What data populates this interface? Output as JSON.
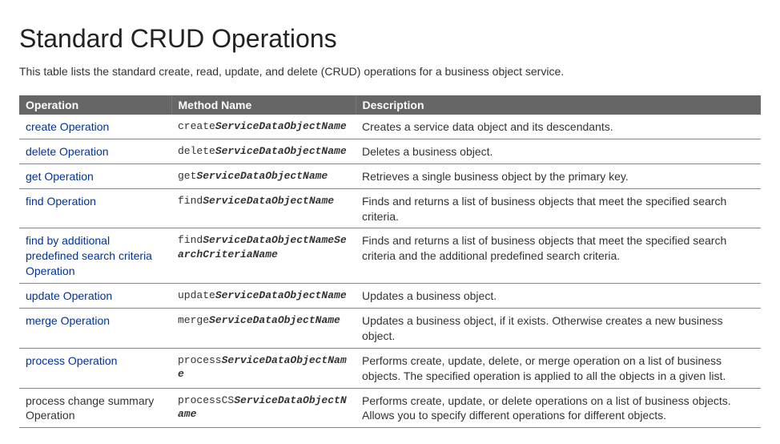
{
  "title": "Standard CRUD Operations",
  "intro": "This table lists the standard create, read, update, and delete (CRUD) operations for a business object service.",
  "header": {
    "operation": "Operation",
    "method": "Method Name",
    "description": "Description"
  },
  "rows": [
    {
      "operation": "create Operation",
      "is_link": true,
      "method_prefix": "create",
      "method_var": "ServiceDataObjectName",
      "description": "Creates a service data object and its descendants."
    },
    {
      "operation": "delete Operation",
      "is_link": true,
      "method_prefix": "delete",
      "method_var": "ServiceDataObjectName",
      "description": "Deletes a business object."
    },
    {
      "operation": "get Operation",
      "is_link": true,
      "method_prefix": "get",
      "method_var": "ServiceDataObjectName",
      "description": "Retrieves a single business object by the primary key."
    },
    {
      "operation": "find Operation",
      "is_link": true,
      "method_prefix": "find",
      "method_var": "ServiceDataObjectName",
      "description": "Finds and returns a list of business objects that meet the specified search criteria."
    },
    {
      "operation": "find by additional predefined search criteria Operation",
      "is_link": true,
      "method_prefix": "find",
      "method_var": "ServiceDataObjectNameSearchCriteriaName",
      "description": "Finds and returns a list of business objects that meet the specified search criteria and the additional predefined search criteria."
    },
    {
      "operation": "update Operation",
      "is_link": true,
      "method_prefix": "update",
      "method_var": "ServiceDataObjectName",
      "description": "Updates a business object."
    },
    {
      "operation": "merge Operation",
      "is_link": true,
      "method_prefix": "merge",
      "method_var": "ServiceDataObjectName",
      "description": "Updates a business object, if it exists. Otherwise creates a new business object."
    },
    {
      "operation": "process Operation",
      "is_link": true,
      "method_prefix": "process",
      "method_var": "ServiceDataObjectName",
      "description": "Performs create, update, delete, or merge operation on a list of business objects. The specified operation is applied to all the objects in a given list."
    },
    {
      "operation": "process change summary Operation",
      "is_link": false,
      "method_prefix": "processCS",
      "method_var": "ServiceDataObjectName",
      "description": "Performs create, update, or delete operations on a list of business objects. Allows you to specify different operations for different objects."
    }
  ]
}
